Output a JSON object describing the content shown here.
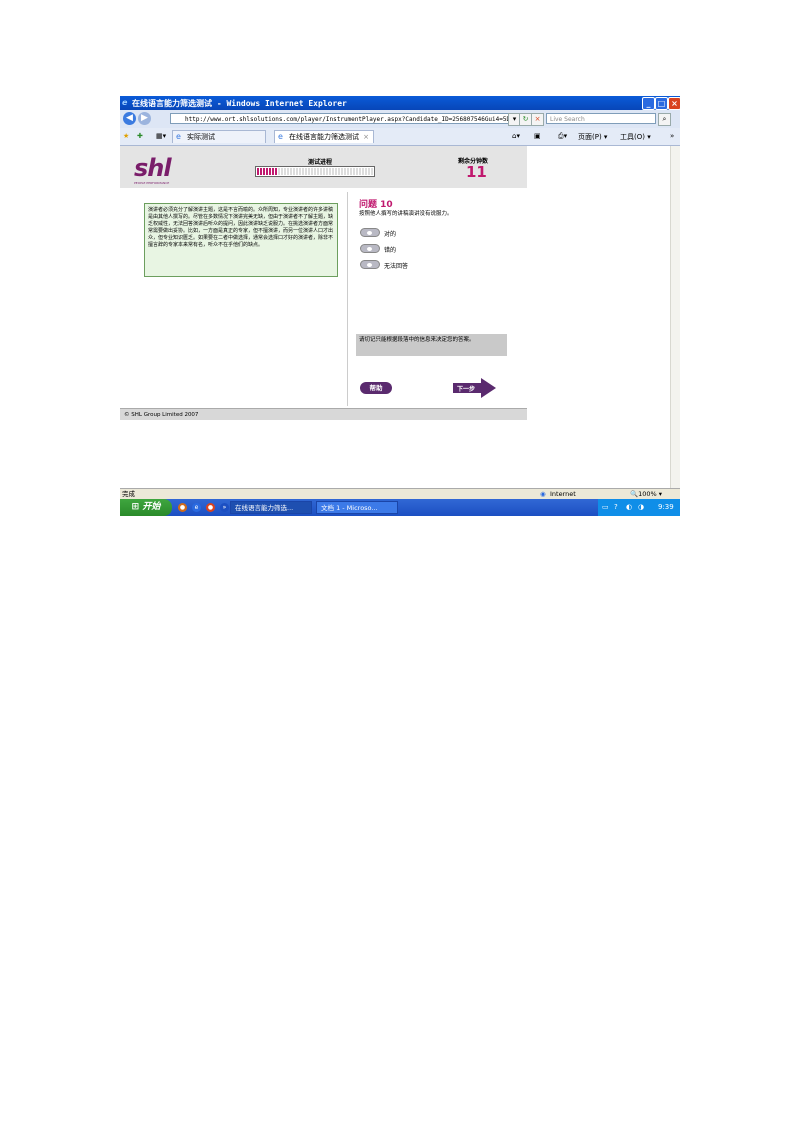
{
  "browser": {
    "title": "在线语言能力筛选测试 - Windows Internet Explorer",
    "address": "http://www.ort.shlsolutions.com/player/InstrumentPlayer.aspx?Candidate_ID=256807546Gui4=5D3B36BD-F07C",
    "search_placeholder": "Live Search",
    "tabs": [
      "实际测试",
      "在线语言能力筛选测试"
    ],
    "page_menu": "页面(P)",
    "tools_menu": "工具(O)"
  },
  "test": {
    "logo": "shl",
    "logo_tagline": "PEOPLE PERFORMANCE",
    "progress_label": "测试进程",
    "progress_value": 0.18,
    "time_label": "剩余分钟数",
    "time_value": "11",
    "passage": "演讲者必须充分了解演讲主题，这是不言而喻的。众所周知，专业演讲者的许多讲稿是由其他人撰写的。尽管在多数情况下演讲完美无缺，但由于演讲者不了解主题，缺乏权威性，无法回答演讲后听众的提问，因此演讲缺乏说服力。在挑选演讲者方面常常需要做出妥协。比如，一方面是真正的专家，但不擅演讲，而另一位演讲人口才出众，但专业知识匮乏。如果要在二者中做选择，通常会选择口才好的演讲者，除非不擅言辞的专家本来常有名，听众不在乎他们的缺点。",
    "question_title": "问题 10",
    "question_text": "按照他人撰写的讲稿演讲没有说服力。",
    "options": [
      "对的",
      "错的",
      "无法回答"
    ],
    "note": "请切记只能根据段落中的信息来决定您的答案。",
    "help_label": "帮助",
    "next_label": "下一步",
    "footer": "© SHL Group Limited 2007"
  },
  "status": {
    "left": "完成",
    "zone": "Internet",
    "zoom": "100%"
  },
  "taskbar": {
    "start": "开始",
    "tasks": [
      "在线语言能力筛选...",
      "文档 1 - Microso..."
    ],
    "clock": "9:39"
  }
}
